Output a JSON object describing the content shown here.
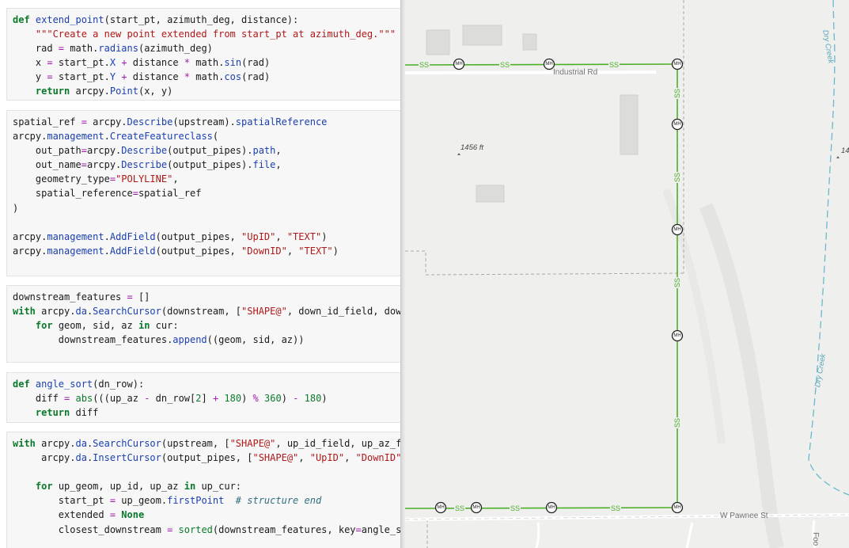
{
  "notebook": {
    "cells": [
      {
        "id": "extend-point",
        "lines": [
          [
            {
              "t": "def ",
              "c": "kw"
            },
            {
              "t": "extend_point",
              "c": "fn"
            },
            {
              "t": "(start_pt, azimuth_deg, distance):"
            }
          ],
          [
            {
              "t": "    "
            },
            {
              "t": "\"\"\"Create a new point extended from start_pt at azimuth_deg.\"\"\"",
              "c": "st"
            }
          ],
          [
            {
              "t": "    rad "
            },
            {
              "t": "=",
              "c": "op"
            },
            {
              "t": " math."
            },
            {
              "t": "radians",
              "c": "fn"
            },
            {
              "t": "(azimuth_deg)"
            }
          ],
          [
            {
              "t": "    x "
            },
            {
              "t": "=",
              "c": "op"
            },
            {
              "t": " start_pt."
            },
            {
              "t": "X",
              "c": "fn"
            },
            {
              "t": " "
            },
            {
              "t": "+",
              "c": "op"
            },
            {
              "t": " distance "
            },
            {
              "t": "*",
              "c": "op"
            },
            {
              "t": " math."
            },
            {
              "t": "sin",
              "c": "fn"
            },
            {
              "t": "(rad)"
            }
          ],
          [
            {
              "t": "    y "
            },
            {
              "t": "=",
              "c": "op"
            },
            {
              "t": " start_pt."
            },
            {
              "t": "Y",
              "c": "fn"
            },
            {
              "t": " "
            },
            {
              "t": "+",
              "c": "op"
            },
            {
              "t": " distance "
            },
            {
              "t": "*",
              "c": "op"
            },
            {
              "t": " math."
            },
            {
              "t": "cos",
              "c": "fn"
            },
            {
              "t": "(rad)"
            }
          ],
          [
            {
              "t": "    "
            },
            {
              "t": "return",
              "c": "kw"
            },
            {
              "t": " arcpy."
            },
            {
              "t": "Point",
              "c": "fn"
            },
            {
              "t": "(x, y)"
            }
          ]
        ]
      },
      {
        "id": "create-featureclass",
        "lines": [
          [
            {
              "t": "spatial_ref "
            },
            {
              "t": "=",
              "c": "op"
            },
            {
              "t": " arcpy."
            },
            {
              "t": "Describe",
              "c": "fn"
            },
            {
              "t": "(upstream)."
            },
            {
              "t": "spatialReference",
              "c": "fn"
            }
          ],
          [
            {
              "t": "arcpy."
            },
            {
              "t": "management",
              "c": "fn"
            },
            {
              "t": "."
            },
            {
              "t": "CreateFeatureclass",
              "c": "fn"
            },
            {
              "t": "("
            }
          ],
          [
            {
              "t": "    out_path"
            },
            {
              "t": "=",
              "c": "op"
            },
            {
              "t": "arcpy."
            },
            {
              "t": "Describe",
              "c": "fn"
            },
            {
              "t": "(output_pipes)."
            },
            {
              "t": "path",
              "c": "fn"
            },
            {
              "t": ","
            }
          ],
          [
            {
              "t": "    out_name"
            },
            {
              "t": "=",
              "c": "op"
            },
            {
              "t": "arcpy."
            },
            {
              "t": "Describe",
              "c": "fn"
            },
            {
              "t": "(output_pipes)."
            },
            {
              "t": "file",
              "c": "fn"
            },
            {
              "t": ","
            }
          ],
          [
            {
              "t": "    geometry_type"
            },
            {
              "t": "=",
              "c": "op"
            },
            {
              "t": "\"POLYLINE\"",
              "c": "st"
            },
            {
              "t": ","
            }
          ],
          [
            {
              "t": "    spatial_reference"
            },
            {
              "t": "=",
              "c": "op"
            },
            {
              "t": "spatial_ref"
            }
          ],
          [
            {
              "t": ")"
            }
          ],
          [
            {
              "t": ""
            }
          ],
          [
            {
              "t": "arcpy."
            },
            {
              "t": "management",
              "c": "fn"
            },
            {
              "t": "."
            },
            {
              "t": "AddField",
              "c": "fn"
            },
            {
              "t": "(output_pipes, "
            },
            {
              "t": "\"UpID\"",
              "c": "st"
            },
            {
              "t": ", "
            },
            {
              "t": "\"TEXT\"",
              "c": "st"
            },
            {
              "t": ")"
            }
          ],
          [
            {
              "t": "arcpy."
            },
            {
              "t": "management",
              "c": "fn"
            },
            {
              "t": "."
            },
            {
              "t": "AddField",
              "c": "fn"
            },
            {
              "t": "(output_pipes, "
            },
            {
              "t": "\"DownID\"",
              "c": "st"
            },
            {
              "t": ", "
            },
            {
              "t": "\"TEXT\"",
              "c": "st"
            },
            {
              "t": ")"
            }
          ]
        ]
      },
      {
        "id": "downstream-features",
        "lines": [
          [
            {
              "t": "downstream_features "
            },
            {
              "t": "=",
              "c": "op"
            },
            {
              "t": " []"
            }
          ],
          [
            {
              "t": "with",
              "c": "kw"
            },
            {
              "t": " arcpy."
            },
            {
              "t": "da",
              "c": "fn"
            },
            {
              "t": "."
            },
            {
              "t": "SearchCursor",
              "c": "fn"
            },
            {
              "t": "(downstream, ["
            },
            {
              "t": "\"SHAPE@\"",
              "c": "st"
            },
            {
              "t": ", down_id_field, down"
            }
          ],
          [
            {
              "t": "    "
            },
            {
              "t": "for",
              "c": "kw"
            },
            {
              "t": " geom, sid, az "
            },
            {
              "t": "in",
              "c": "kw"
            },
            {
              "t": " cur:"
            }
          ],
          [
            {
              "t": "        downstream_features."
            },
            {
              "t": "append",
              "c": "fn"
            },
            {
              "t": "((geom, sid, az))"
            }
          ]
        ]
      },
      {
        "id": "angle-sort",
        "lines": [
          [
            {
              "t": "def ",
              "c": "kw"
            },
            {
              "t": "angle_sort",
              "c": "fn"
            },
            {
              "t": "(dn_row):"
            }
          ],
          [
            {
              "t": "    diff "
            },
            {
              "t": "=",
              "c": "op"
            },
            {
              "t": " "
            },
            {
              "t": "abs",
              "c": "nm"
            },
            {
              "t": "(((up_az "
            },
            {
              "t": "-",
              "c": "op"
            },
            {
              "t": " dn_row["
            },
            {
              "t": "2",
              "c": "nm"
            },
            {
              "t": "] "
            },
            {
              "t": "+",
              "c": "op"
            },
            {
              "t": " "
            },
            {
              "t": "180",
              "c": "nm"
            },
            {
              "t": ") "
            },
            {
              "t": "%",
              "c": "op"
            },
            {
              "t": " "
            },
            {
              "t": "360",
              "c": "nm"
            },
            {
              "t": ") "
            },
            {
              "t": "-",
              "c": "op"
            },
            {
              "t": " "
            },
            {
              "t": "180",
              "c": "nm"
            },
            {
              "t": ")"
            }
          ],
          [
            {
              "t": "    "
            },
            {
              "t": "return",
              "c": "kw"
            },
            {
              "t": " diff"
            }
          ]
        ]
      },
      {
        "id": "main-loop",
        "lines": [
          [
            {
              "t": "with",
              "c": "kw"
            },
            {
              "t": " arcpy."
            },
            {
              "t": "da",
              "c": "fn"
            },
            {
              "t": "."
            },
            {
              "t": "SearchCursor",
              "c": "fn"
            },
            {
              "t": "(upstream, ["
            },
            {
              "t": "\"SHAPE@\"",
              "c": "st"
            },
            {
              "t": ", up_id_field, up_az_fi"
            }
          ],
          [
            {
              "t": "     arcpy."
            },
            {
              "t": "da",
              "c": "fn"
            },
            {
              "t": "."
            },
            {
              "t": "InsertCursor",
              "c": "fn"
            },
            {
              "t": "(output_pipes, ["
            },
            {
              "t": "\"SHAPE@\"",
              "c": "st"
            },
            {
              "t": ", "
            },
            {
              "t": "\"UpID\"",
              "c": "st"
            },
            {
              "t": ", "
            },
            {
              "t": "\"DownID\"",
              "c": "st"
            },
            {
              "t": "]"
            }
          ],
          [
            {
              "t": ""
            }
          ],
          [
            {
              "t": "    "
            },
            {
              "t": "for",
              "c": "kw"
            },
            {
              "t": " up_geom, up_id, up_az "
            },
            {
              "t": "in",
              "c": "kw"
            },
            {
              "t": " up_cur:"
            }
          ],
          [
            {
              "t": "        start_pt "
            },
            {
              "t": "=",
              "c": "op"
            },
            {
              "t": " up_geom."
            },
            {
              "t": "firstPoint",
              "c": "fn"
            },
            {
              "t": "  "
            },
            {
              "t": "# structure end",
              "c": "cm"
            }
          ],
          [
            {
              "t": "        extended "
            },
            {
              "t": "=",
              "c": "op"
            },
            {
              "t": " "
            },
            {
              "t": "None",
              "c": "kw"
            }
          ],
          [
            {
              "t": "        closest_downstream "
            },
            {
              "t": "=",
              "c": "op"
            },
            {
              "t": " "
            },
            {
              "t": "sorted",
              "c": "nm"
            },
            {
              "t": "(downstream_features, key"
            },
            {
              "t": "=",
              "c": "op"
            },
            {
              "t": "angle_so"
            }
          ]
        ]
      }
    ]
  },
  "map": {
    "road_labels": {
      "industrial": "Industrial Rd",
      "pawnee": "W Pawnee St",
      "partial": "Foo"
    },
    "creek_labels": [
      "Dry Creek",
      "Dry Creek"
    ],
    "spot_elevations": [
      "1456 ft",
      "14"
    ],
    "sewer_label": "SS",
    "manhole_label": "MH",
    "colors": {
      "pipe": "#4caf28",
      "road": "#ffffff",
      "background": "#efefed",
      "creek": "#6ab8cc",
      "parcel": "#a9a9a9",
      "building": "#dcdcd8"
    }
  }
}
